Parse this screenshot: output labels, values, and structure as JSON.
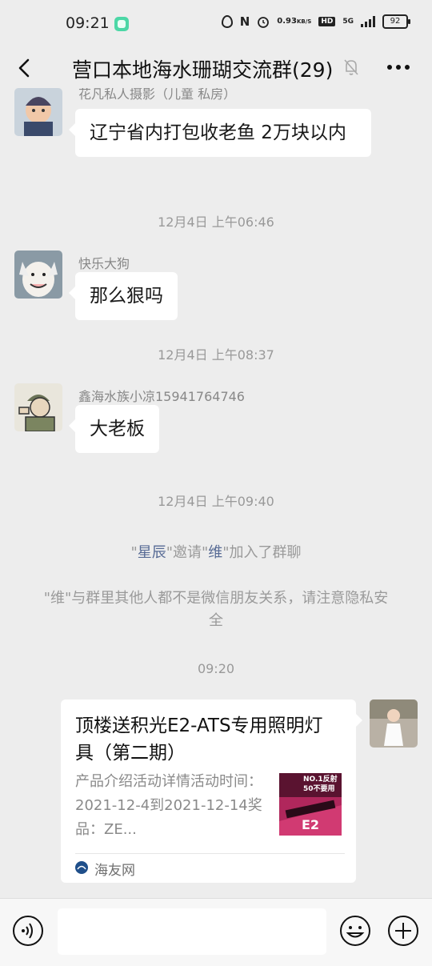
{
  "status_bar": {
    "time": "09:21",
    "net_speed_value": "0.93",
    "net_speed_unit": "KB/S",
    "hd": "HD",
    "network": "5G",
    "battery": "92"
  },
  "header": {
    "title": "营口本地海水珊瑚交流群(29)"
  },
  "messages": [
    {
      "sender": "花凡私人摄影（儿童 私房）",
      "text": "辽宁省内打包收老鱼 2万块以内"
    },
    {
      "sender": "快乐大狗",
      "text": "那么狠吗"
    },
    {
      "sender": "鑫海水族小凉15941764746",
      "text": "大老板"
    }
  ],
  "timestamps": [
    "12月4日 上午06:46",
    "12月4日 上午08:37",
    "12月4日 上午09:40",
    "09:20"
  ],
  "system": {
    "invite": {
      "q1": "\"",
      "inviter": "星辰",
      "q2": "\"邀请\"",
      "invitee": "维",
      "q3": "\"加入了群聊"
    },
    "warning": "\"维\"与群里其他人都不是微信朋友关系，请注意隐私安全"
  },
  "link_card": {
    "title": "顶楼送积光E2-ATS专用照明灯具（第二期）",
    "description": "产品介绍活动详情活动时间：2021-12-4到2021-12-14奖品：ZE...",
    "thumb_line1": "NO.1反射",
    "thumb_line2": "50不要用",
    "thumb_e2": "E2",
    "source": "海友网"
  },
  "input": {
    "value": ""
  },
  "colors": {
    "background": "#EDEDED",
    "link_blue": "#576B95",
    "bubble": "#FFFFFF"
  },
  "icons": [
    "back-arrow-icon",
    "mute-bell-icon",
    "more-dots-icon",
    "voice-icon",
    "emoji-icon",
    "plus-icon"
  ]
}
